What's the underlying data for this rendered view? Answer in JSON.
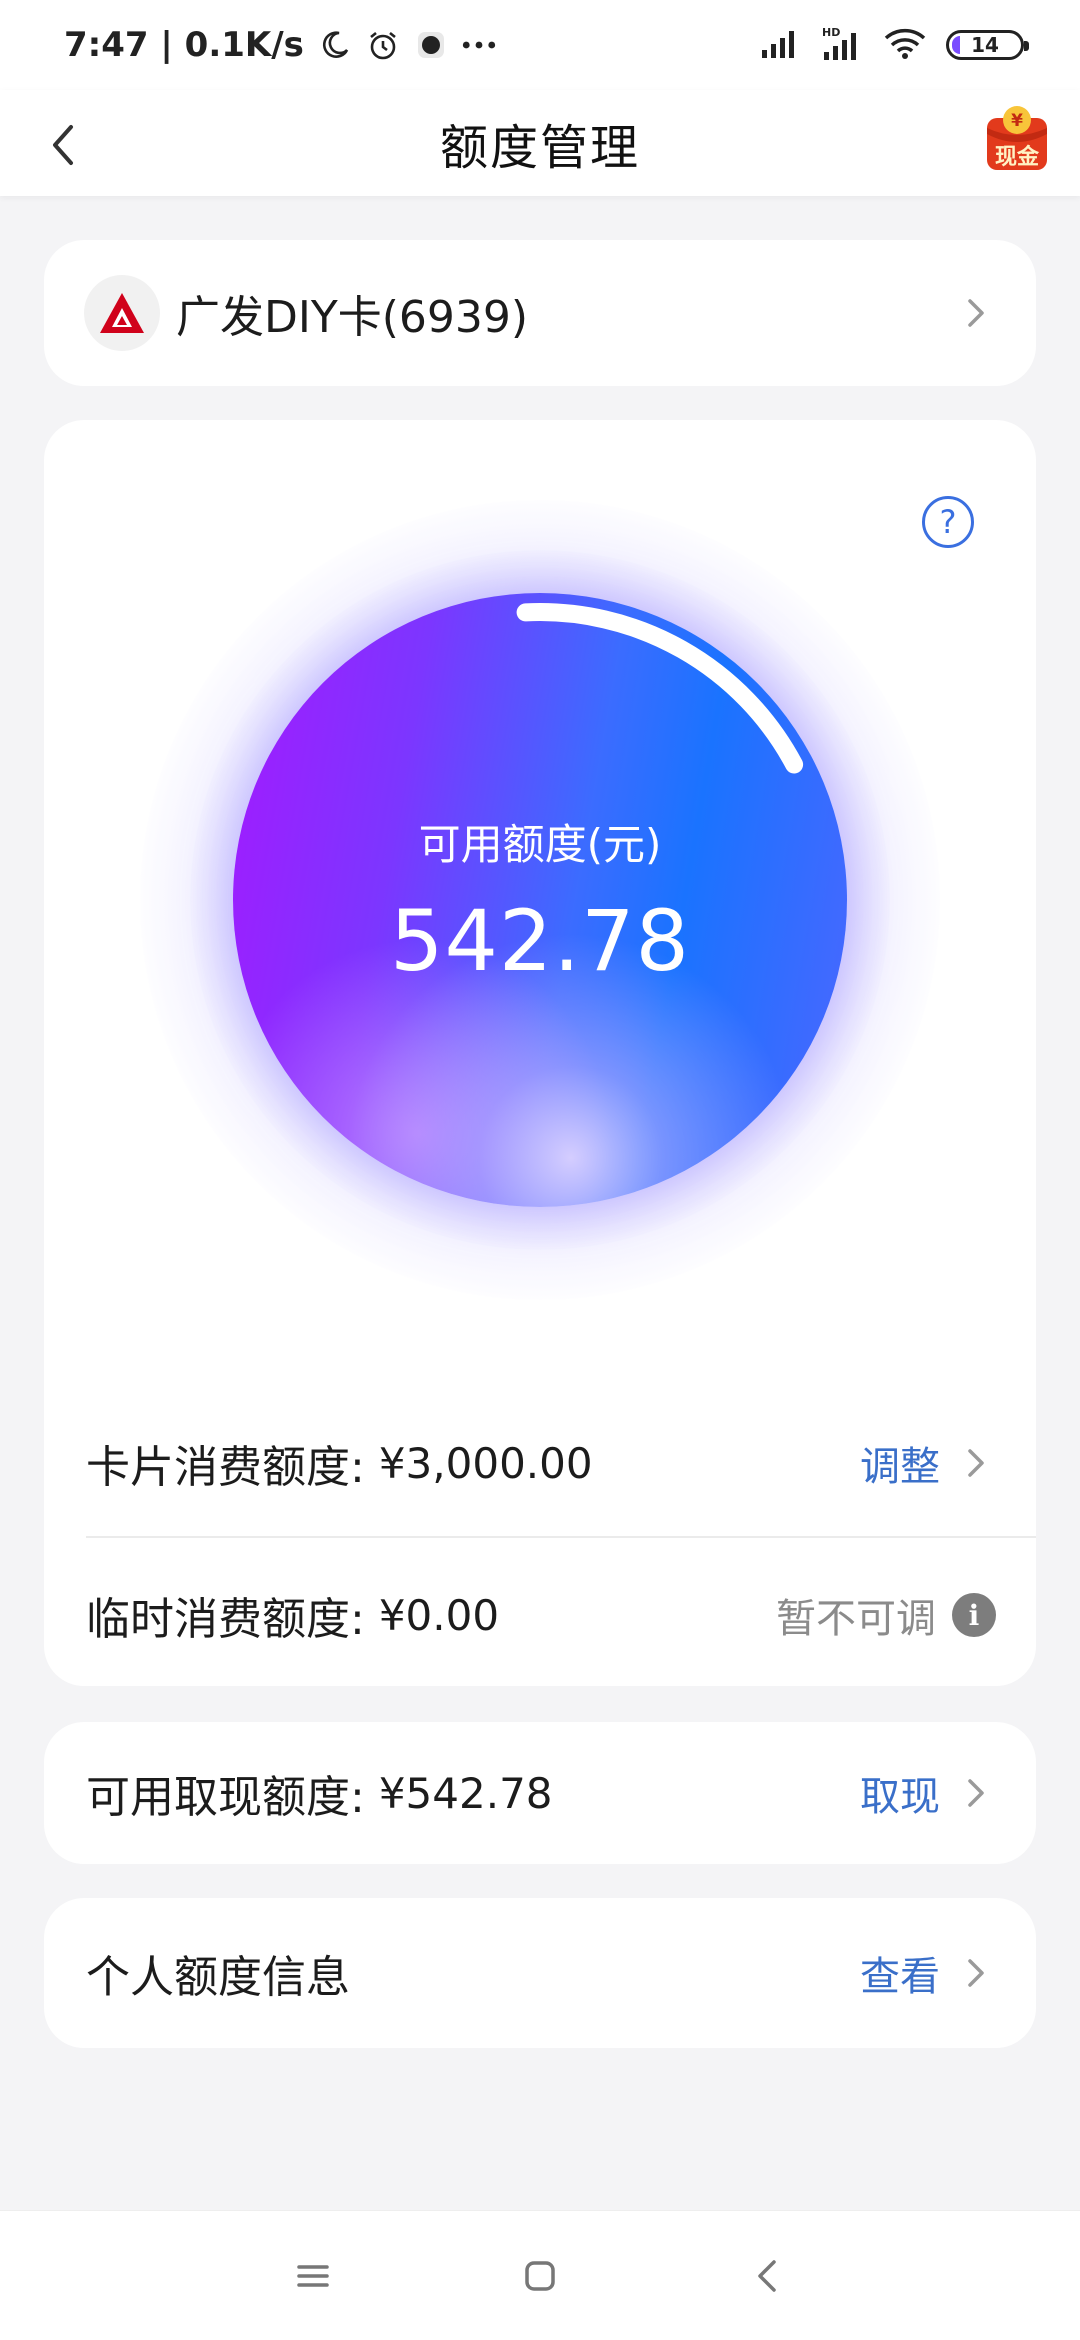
{
  "status_bar": {
    "time_speed": "7:47 | 0.1K/s",
    "battery": "14",
    "icons": [
      "moon-icon",
      "alarm-icon",
      "app-icon",
      "more-dots-icon",
      "signal-icon",
      "hd-signal-icon",
      "wifi-icon",
      "battery-icon"
    ]
  },
  "header": {
    "title": "额度管理",
    "cash_badge_symbol": "¥",
    "cash_badge_label": "现金"
  },
  "card_selector": {
    "card_name": "广发DIY卡(6939)"
  },
  "limit": {
    "available_label": "可用额度(元)",
    "available_value": "542.78",
    "usage_fraction": 0.18,
    "help_symbol": "?"
  },
  "rows": {
    "card_limit": {
      "label": "卡片消费额度:",
      "value": "¥3,000.00",
      "action": "调整"
    },
    "temp_limit": {
      "label": "临时消费额度:",
      "value": "¥0.00",
      "action": "暂不可调",
      "info_symbol": "i"
    },
    "cash_limit": {
      "label": "可用取现额度:",
      "value": "¥542.78",
      "action": "取现"
    },
    "personal_info": {
      "label": "个人额度信息",
      "action": "查看"
    }
  },
  "colors": {
    "accent_link": "#3a6fc9",
    "orb_purple": "#a419ff",
    "orb_blue": "#1a73ff",
    "bank_red": "#d0021b"
  }
}
